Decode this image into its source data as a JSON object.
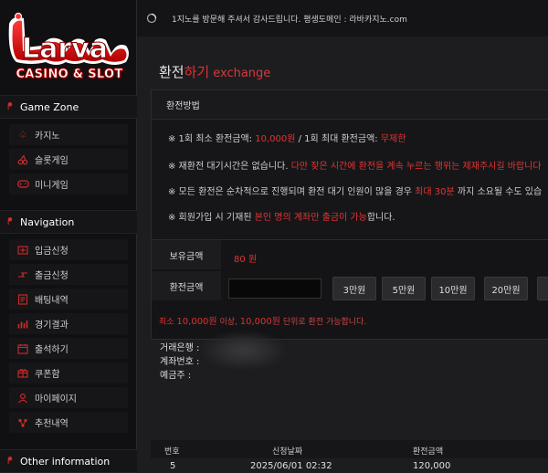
{
  "brand": {
    "logo_word": "Larva",
    "logo_sub": "CASINO & SLOT"
  },
  "sidebar": {
    "sections": [
      {
        "title": "Game Zone",
        "icon": "logo-icon",
        "items": [
          {
            "label": "카지노",
            "icon": "spade-icon"
          },
          {
            "label": "슬롯게임",
            "icon": "cherry-icon"
          },
          {
            "label": "미니게임",
            "icon": "gamepad-icon"
          }
        ]
      },
      {
        "title": "Navigation",
        "icon": "logo-icon",
        "items": [
          {
            "label": "입금신청",
            "icon": "deposit-icon"
          },
          {
            "label": "출금신청",
            "icon": "withdraw-icon"
          },
          {
            "label": "배팅내역",
            "icon": "betting-history-icon"
          },
          {
            "label": "경기결과",
            "icon": "results-icon"
          },
          {
            "label": "출석하기",
            "icon": "calendar-icon"
          },
          {
            "label": "쿠폰함",
            "icon": "coupon-icon"
          },
          {
            "label": "마이페이지",
            "icon": "user-icon"
          },
          {
            "label": "추천내역",
            "icon": "referral-icon"
          }
        ]
      },
      {
        "title": "Other information",
        "icon": "logo-icon"
      }
    ]
  },
  "topbar": {
    "notice": "1지노를 방문해 주셔서 감사드립니다.  평생도메인 : 라바카지노.com"
  },
  "page": {
    "title_main": "환전",
    "title_accent": "하기",
    "title_en": "exchange"
  },
  "method": {
    "heading": "환전방법",
    "lines": [
      {
        "pre": "※ 1회 최소 환전금액: ",
        "red1": "10,000원",
        "mid": " / 1회 최대 환전금액: ",
        "red2": "무제한"
      },
      {
        "pre": "※ 재환전 대기시간은 없습니다. ",
        "red1": "다만 잦은 시간에 환전을 계속 누르는 행위는 제재주시길 바랍니다",
        "mid": "",
        "red2": ""
      },
      {
        "pre": "※ 모든 환전은 순차적으로 진행되며 환전 대기 인원이 많을 경우 ",
        "red1": "최대 30분",
        "mid": " 까지 소요될 수도 있습",
        "red2": ""
      },
      {
        "pre": "※ 회원가입 시 기재된 ",
        "red1": "본인 명의 계좌만 출금이 가능",
        "mid": "합니다.",
        "red2": ""
      }
    ]
  },
  "form": {
    "hold_label": "보유금액",
    "hold_value": "80 원",
    "amount_label": "환전금액",
    "amount_value": "",
    "amount_buttons": [
      "3만원",
      "5만원",
      "10만원",
      "20만원"
    ],
    "note_pre": "최소 ",
    "note_min": "10,000원",
    "note_mid": " 이상, ",
    "note_unit": "10,000원",
    "note_post": " 단위로 환전 가능합니다."
  },
  "bank_info": {
    "bank_label": "거래은행 :",
    "account_label": "계좌번호 :",
    "holder_label": "예금주 :"
  },
  "table": {
    "headers": [
      "번호",
      "신청날짜",
      "환전금액"
    ],
    "rows": [
      {
        "no": "5",
        "date": "2025/06/01 02:32",
        "amount": "120,000"
      }
    ]
  },
  "colors": {
    "accent": "#e03232",
    "bg": "#1d1d1f",
    "sidebar_bg": "#101012"
  }
}
